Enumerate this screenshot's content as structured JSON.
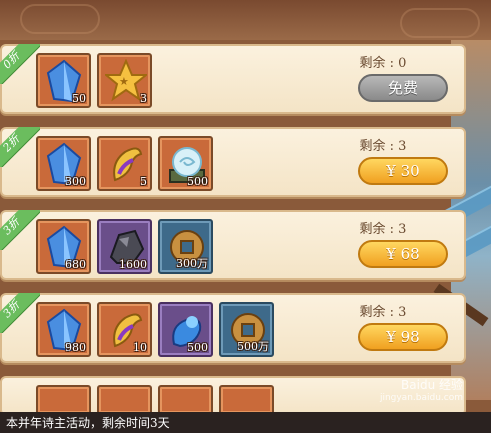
{
  "rows": [
    {
      "discount": "0折",
      "items": [
        {
          "icon": "blue-crystal-icon",
          "count": "50"
        },
        {
          "icon": "golden-star-badge-icon",
          "count": "3"
        }
      ],
      "remain": "剩余 : 0",
      "button": "免费",
      "button_style": "gray"
    },
    {
      "discount": "2折",
      "items": [
        {
          "icon": "blue-crystal-icon",
          "count": "300"
        },
        {
          "icon": "purple-gold-scroll-icon",
          "count": "5"
        },
        {
          "icon": "spirit-orb-icon",
          "count": "500"
        }
      ],
      "remain": "剩余 : 3",
      "button": "¥ 30",
      "button_style": "gold"
    },
    {
      "discount": "3折",
      "items": [
        {
          "icon": "blue-crystal-icon",
          "count": "680"
        },
        {
          "icon": "dark-ore-icon",
          "count": "1600"
        },
        {
          "icon": "copper-coin-icon",
          "count": "300万"
        }
      ],
      "remain": "剩余 : 3",
      "button": "¥ 68",
      "button_style": "gold"
    },
    {
      "discount": "3折",
      "items": [
        {
          "icon": "blue-crystal-icon",
          "count": "980"
        },
        {
          "icon": "purple-gold-scroll-icon",
          "count": "10"
        },
        {
          "icon": "blue-orb-icon",
          "count": "500"
        },
        {
          "icon": "copper-coin-icon",
          "count": "500万"
        }
      ],
      "remain": "剩余 : 3",
      "button": "¥ 98",
      "button_style": "gold"
    }
  ],
  "watermark": {
    "text": "Baidu 经验",
    "url": "jingyan.baidu.com"
  },
  "bottom_bar_text": "本并年诗主活动，剩余时间3天"
}
